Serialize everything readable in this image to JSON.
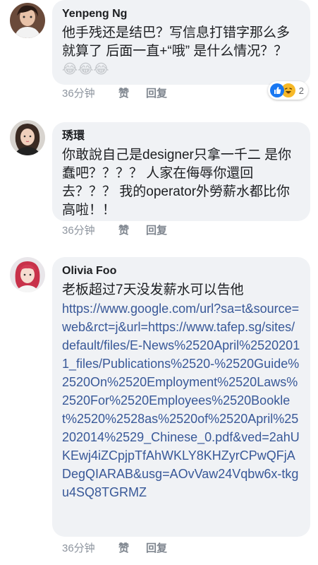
{
  "comments": [
    {
      "author": "Yenpeng Ng",
      "text": "他手残还是结巴？写信息打错字那么多就算了 后面一直+“哦” 是什么情况？？",
      "emoji": "😂😂😂",
      "time": "36分钟",
      "like_label": "赞",
      "reply_label": "回复",
      "reaction_count": "2",
      "reaction_icons": [
        "like-icon",
        "haha-icon"
      ]
    },
    {
      "author": "琇環",
      "text": "你敢說自己是designer只拿一千二 是你蠢吧？？？？ 人家在侮辱你還回去？？？ 我的operator外勞薪水都比你高啦！！",
      "time": "36分钟",
      "like_label": "赞",
      "reply_label": "回复"
    },
    {
      "author": "Olivia Foo",
      "text": "老板超过7天没发薪水可以告他",
      "link": "https://www.google.com/url?sa=t&source=web&rct=j&url=https://www.tafep.sg/sites/default/files/E-News%2520April%25202011_files/Publications%2520-%2520Guide%2520On%2520Employment%2520Laws%2520For%2520Employees%2520Booklet%2520%2528as%2520of%2520April%25202014%2529_Chinese_0.pdf&ved=2ahUKEwj4iZCpjpTfAhWKLY8KHZyrCPwQFjADegQIARAB&usg=AOvVaw24Vqbw6x-tkgu4SQ8TGRMZ",
      "time": "36分钟",
      "like_label": "赞",
      "reply_label": "回复"
    }
  ]
}
